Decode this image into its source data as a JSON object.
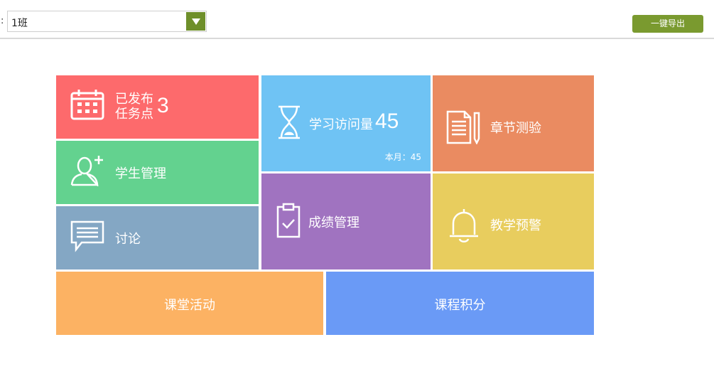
{
  "filter": {
    "colon": ":",
    "selected_class": "1班"
  },
  "toolbar": {
    "export_label": "一键导出"
  },
  "tiles": {
    "published": {
      "label_line1": "已发布",
      "label_line2": "任务点",
      "count": "3",
      "icon": "calendar-icon"
    },
    "students": {
      "label": "学生管理",
      "icon": "add-user-icon"
    },
    "discussion": {
      "label": "讨论",
      "icon": "chat-icon"
    },
    "visits": {
      "label": "学习访问量",
      "count": "45",
      "monthly": "本月：45",
      "icon": "hourglass-icon"
    },
    "grades": {
      "label": "成绩管理",
      "icon": "clipboard-check-icon"
    },
    "quiz": {
      "label": "章节测验",
      "icon": "document-pen-icon"
    },
    "warning": {
      "label": "教学预警",
      "icon": "bell-icon"
    },
    "activity": {
      "label": "课堂活动"
    },
    "points": {
      "label": "课程积分"
    }
  },
  "colors": {
    "published": "#fd6a6c",
    "students": "#63d28f",
    "discussion": "#84a7c4",
    "visits": "#6fc3f4",
    "grades": "#a073c0",
    "quiz": "#ea8b61",
    "warning": "#e8cd5e",
    "activity": "#fcb263",
    "points": "#6a9af6",
    "accent_green": "#7a9a2f"
  }
}
